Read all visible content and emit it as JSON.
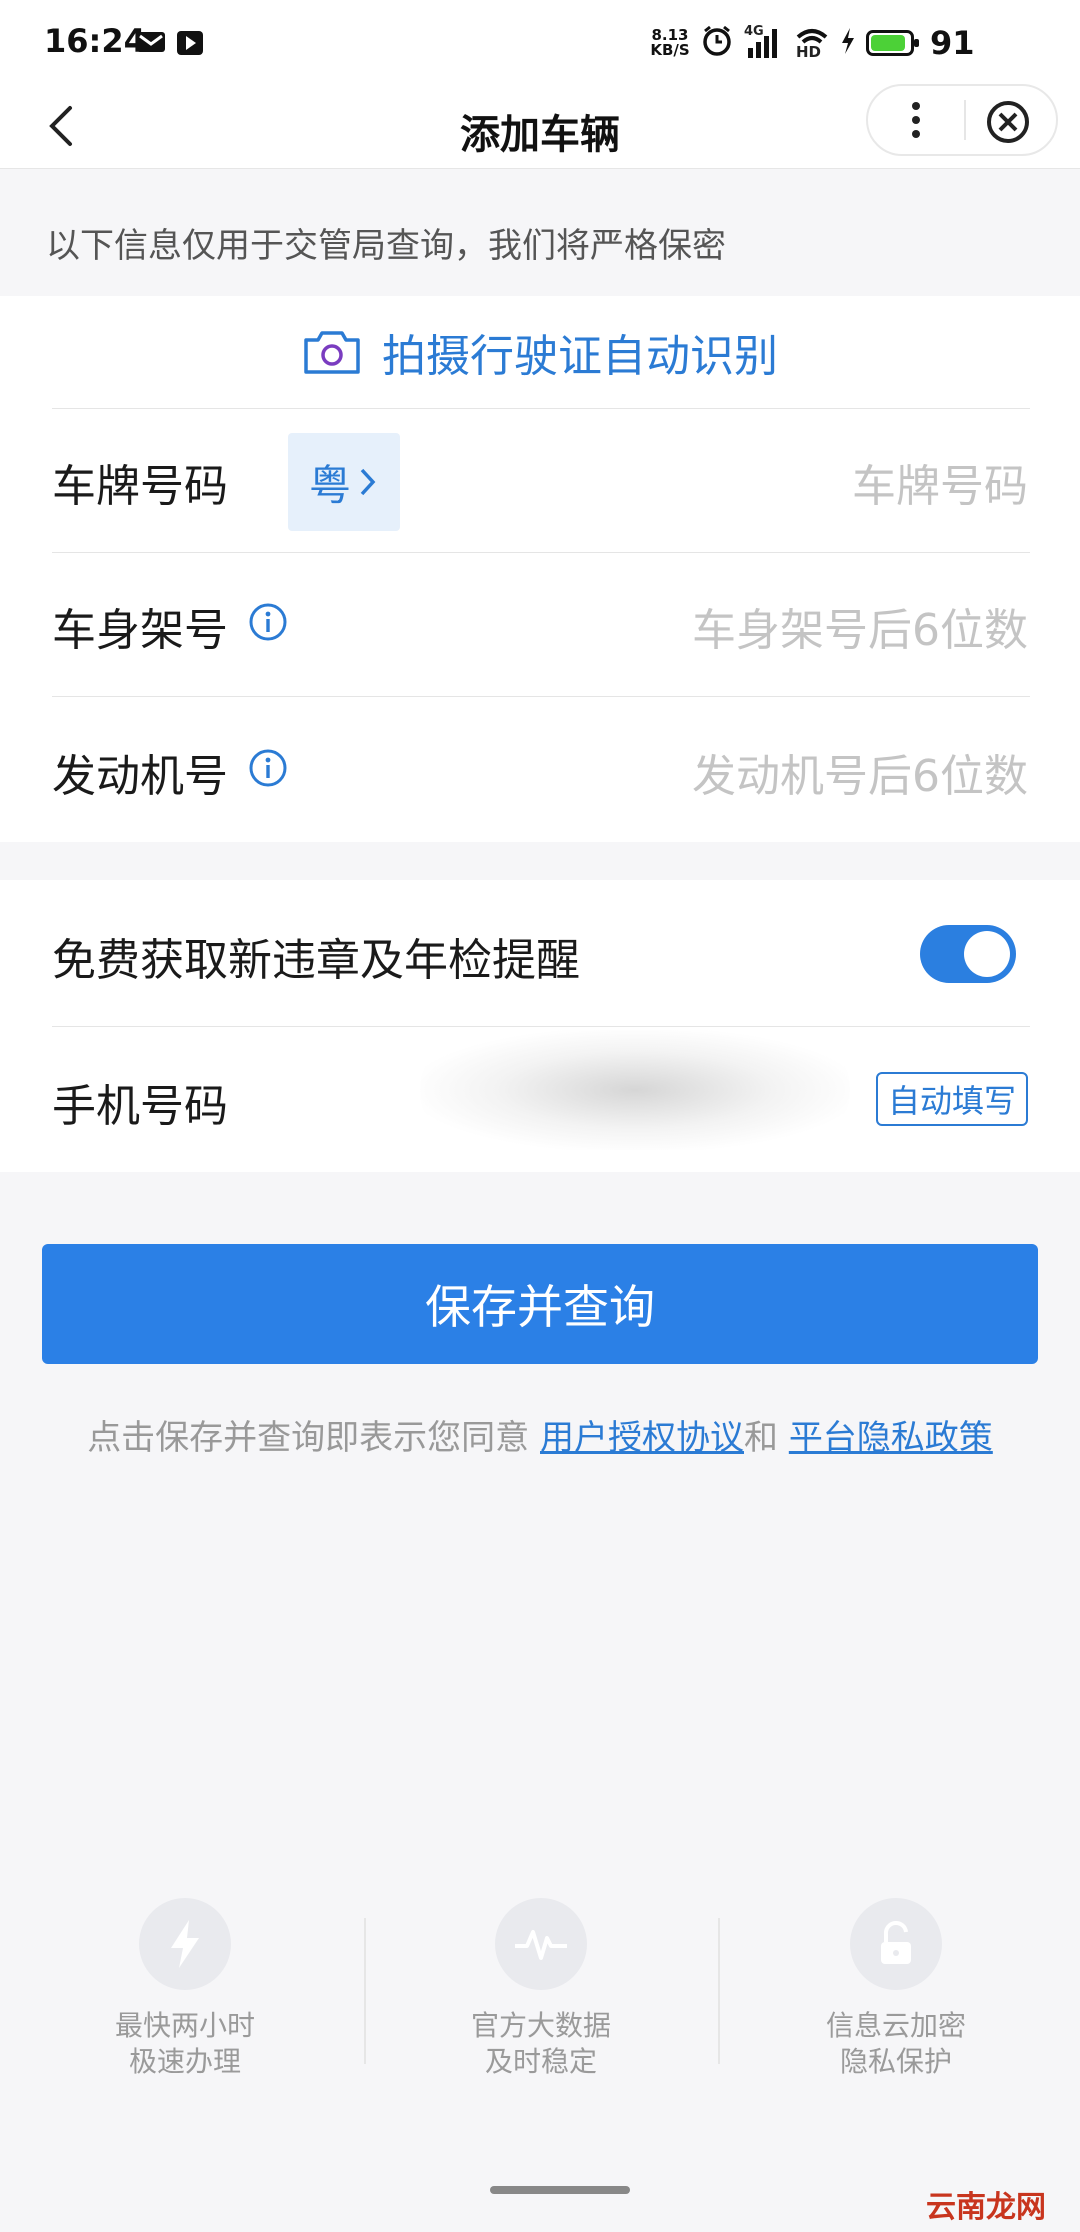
{
  "status_bar": {
    "time": "16:24",
    "net_speed_value": "8.13",
    "net_speed_unit": "KB/S",
    "signal_label": "4G",
    "hd_label": "HD",
    "battery_level": 91,
    "battery_text": "91"
  },
  "nav": {
    "title": "添加车辆"
  },
  "note": "以下信息仅用于交管局查询，我们将严格保密",
  "scan": {
    "label": "拍摄行驶证自动识别"
  },
  "form": {
    "plate": {
      "label": "车牌号码",
      "province": "粤",
      "placeholder": "车牌号码"
    },
    "vin": {
      "label": "车身架号",
      "placeholder": "车身架号后6位数"
    },
    "engine": {
      "label": "发动机号",
      "placeholder": "发动机号后6位数"
    }
  },
  "reminder": {
    "label": "免费获取新违章及年检提醒",
    "enabled": true
  },
  "phone": {
    "label": "手机号码",
    "autofill_label": "自动填写"
  },
  "save_button": "保存并查询",
  "agreement": {
    "prefix": "点击保存并查询即表示您同意",
    "link1": "用户授权协议",
    "connector": "和",
    "link2": "平台隐私政策"
  },
  "features": [
    {
      "icon": "lightning-icon",
      "line1": "最快两小时",
      "line2": "极速办理"
    },
    {
      "icon": "pulse-icon",
      "line1": "官方大数据",
      "line2": "及时稳定"
    },
    {
      "icon": "lock-icon",
      "line1": "信息云加密",
      "line2": "隐私保护"
    }
  ],
  "watermark": "云南龙网",
  "colors": {
    "accent": "#2b80e6",
    "link": "#2b7bd4",
    "battery": "#4cd137"
  }
}
